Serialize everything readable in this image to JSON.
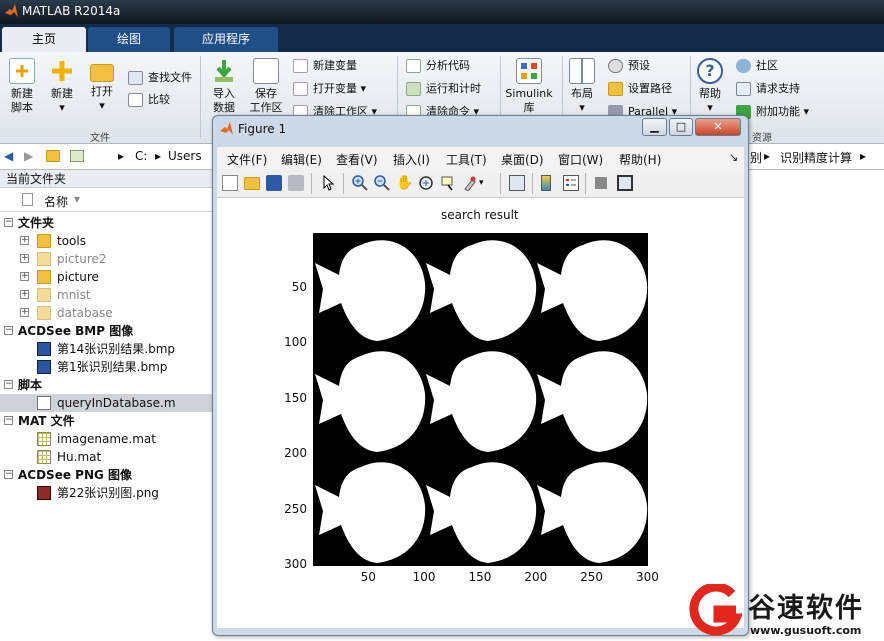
{
  "app": {
    "title": "MATLAB R2014a"
  },
  "tabs": [
    {
      "label": "主页"
    },
    {
      "label": "绘图"
    },
    {
      "label": "应用程序"
    }
  ],
  "ribbon": {
    "new_script": "新建\n脚本",
    "new": "新建",
    "open": "打开",
    "find_files": "查找文件",
    "compare": "比较",
    "file_group": "文件",
    "import_data": "导入\n数据",
    "save_workspace": "保存\n工作区",
    "new_variable": "新建变量",
    "open_variable": "打开变量",
    "clear_workspace": "清除工作区",
    "analyze_code": "分析代码",
    "run_and_time": "运行和计时",
    "clear_commands": "清除命令",
    "simulink": "Simulink\n库",
    "layout": "布局",
    "preferences": "预设",
    "set_path": "设置路径",
    "parallel": "Parallel",
    "help": "帮助",
    "community": "社区",
    "request_support": "请求支持",
    "add_ons": "附加功能",
    "resources_group": "资源"
  },
  "address": {
    "c": "C:",
    "users": "Users",
    "tail1": "别",
    "tail2": "识别精度计算"
  },
  "file_browser": {
    "header": "当前文件夹",
    "col_name": "名称",
    "groups": [
      {
        "label": "文件夹",
        "items": [
          "tools",
          "picture2",
          "picture",
          "mnist",
          "database"
        ]
      },
      {
        "label": "ACDSee BMP 图像",
        "items": [
          "第14张识别结果.bmp",
          "第1张识别结果.bmp"
        ]
      },
      {
        "label": "脚本",
        "items": [
          "queryInDatabase.m"
        ]
      },
      {
        "label": "MAT 文件",
        "items": [
          "imagename.mat",
          "Hu.mat"
        ]
      },
      {
        "label": "ACDSee PNG 图像",
        "items": [
          "第22张识别图.png"
        ]
      }
    ]
  },
  "figure": {
    "title": "Figure 1",
    "menu": [
      "文件(F)",
      "编辑(E)",
      "查看(V)",
      "插入(I)",
      "工具(T)",
      "桌面(D)",
      "窗口(W)",
      "帮助(H)"
    ],
    "menu_arrow": "↘",
    "plot_title": "search result",
    "x_ticks": [
      "50",
      "100",
      "150",
      "200",
      "250",
      "300"
    ],
    "y_ticks": [
      "50",
      "100",
      "150",
      "200",
      "250",
      "300"
    ]
  },
  "chart_data": {
    "type": "image",
    "title": "search result",
    "xlim": [
      0.5,
      300.5
    ],
    "ylim": [
      0.5,
      300.5
    ],
    "x_ticks": [
      50,
      100,
      150,
      200,
      250,
      300
    ],
    "y_ticks": [
      50,
      100,
      150,
      200,
      250,
      300
    ],
    "grid": "3x3 tiles of white fish silhouettes on black background",
    "y_direction": "reverse"
  },
  "watermark": {
    "name": "谷速软件",
    "url": "www.gusuoft.com"
  },
  "colors": {
    "accent": "#1f4f86",
    "titlebar": "#142a4a",
    "ribbon": "#e9edf2",
    "logo_red": "#e2271d"
  }
}
